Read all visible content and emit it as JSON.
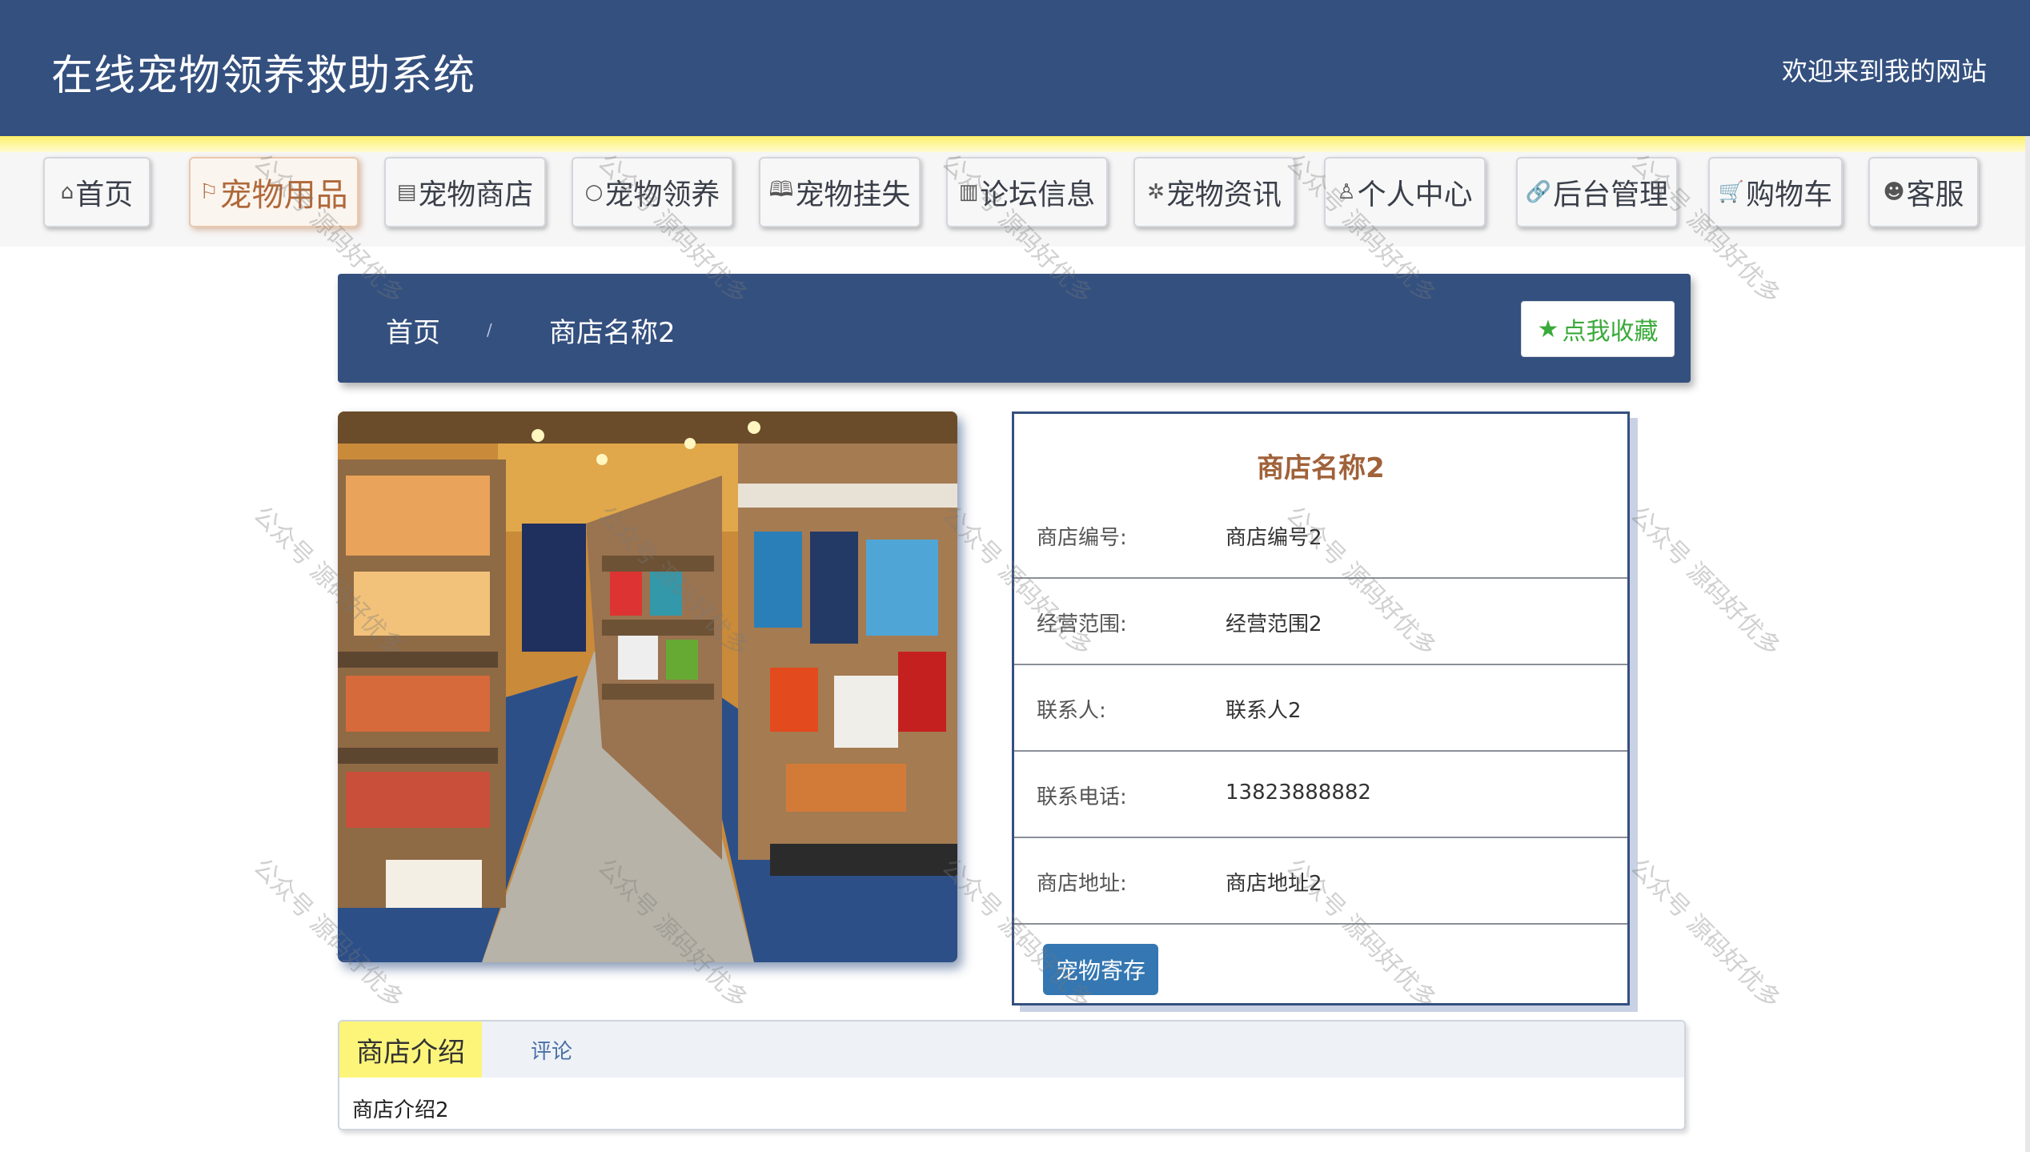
{
  "header": {
    "site_title": "在线宠物领养救助系统",
    "welcome": "欢迎来到我的网站"
  },
  "nav": {
    "items": [
      {
        "icon": "home-icon",
        "glyph": "⌂",
        "label": "首页"
      },
      {
        "icon": "flag-icon",
        "glyph": "⚐",
        "label": "宠物用品"
      },
      {
        "icon": "calendar-icon",
        "glyph": "▤",
        "label": "宠物商店"
      },
      {
        "icon": "circle-icon",
        "glyph": "○",
        "label": "宠物领养"
      },
      {
        "icon": "book-icon",
        "glyph": "🕮",
        "label": "宠物挂失"
      },
      {
        "icon": "chart-icon",
        "glyph": "▥",
        "label": "论坛信息"
      },
      {
        "icon": "spinner-icon",
        "glyph": "✲",
        "label": "宠物资讯"
      },
      {
        "icon": "user-icon",
        "glyph": "♙",
        "label": "个人中心"
      },
      {
        "icon": "link-icon",
        "glyph": "🔗",
        "label": "后台管理"
      },
      {
        "icon": "cart-icon",
        "glyph": "🛒",
        "label": "购物车"
      },
      {
        "icon": "wechat-icon",
        "glyph": "☻",
        "label": "客服"
      }
    ],
    "active_index": 1
  },
  "breadcrumb": {
    "home": "首页",
    "separator": "/",
    "current": "商店名称2",
    "favorite_label": "点我收藏",
    "favorite_glyph": "★"
  },
  "shop": {
    "name": "商店名称2",
    "fields": [
      {
        "label": "商店编号:",
        "value": "商店编号2"
      },
      {
        "label": "经营范围:",
        "value": "经营范围2"
      },
      {
        "label": "联系人:",
        "value": "联系人2"
      },
      {
        "label": "联系电话:",
        "value": "13823888882"
      },
      {
        "label": "商店地址:",
        "value": "商店地址2"
      }
    ],
    "foster_button": "宠物寄存"
  },
  "tabs": {
    "items": [
      "商店介绍",
      "评论"
    ],
    "active_index": 0,
    "content": "商店介绍2"
  },
  "watermark": "公众号 源码好优多",
  "colors": {
    "header_bg": "#34507f",
    "accent_brown": "#a0623a",
    "button_blue": "#3477b2",
    "favorite_green": "#3aaa3a",
    "tab_active_yellow": "#fdf57a"
  }
}
